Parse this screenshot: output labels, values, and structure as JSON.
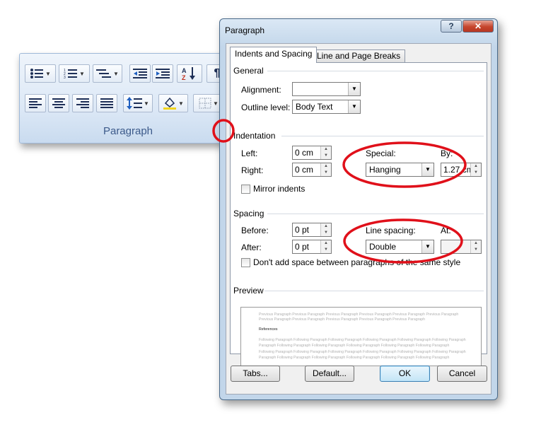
{
  "ribbon": {
    "group_label": "Paragraph",
    "buttons": [
      "bullets-icon",
      "numbering-icon",
      "multilevel-list-icon",
      "decrease-indent-icon",
      "increase-indent-icon",
      "sort-icon",
      "show-marks-icon",
      "align-left-icon",
      "center-icon",
      "align-right-icon",
      "justify-icon",
      "line-spacing-icon",
      "shading-icon",
      "borders-icon"
    ]
  },
  "dialog": {
    "title": "Paragraph",
    "help": "?",
    "close": "✕",
    "tabs": [
      "Indents and Spacing",
      "Line and Page Breaks"
    ],
    "general": {
      "heading": "General",
      "alignment_label": "Alignment:",
      "alignment_value": "",
      "outline_label": "Outline level:",
      "outline_value": "Body Text"
    },
    "indentation": {
      "heading": "Indentation",
      "left_label": "Left:",
      "left_value": "0 cm",
      "right_label": "Right:",
      "right_value": "0 cm",
      "special_label": "Special:",
      "special_value": "Hanging",
      "by_label": "By:",
      "by_value": "1.27 cm",
      "mirror_label": "Mirror indents"
    },
    "spacing": {
      "heading": "Spacing",
      "before_label": "Before:",
      "before_value": "0 pt",
      "after_label": "After:",
      "after_value": "0 pt",
      "line_spacing_label": "Line spacing:",
      "line_spacing_value": "Double",
      "at_label": "At:",
      "at_value": "",
      "dont_add_label": "Don't add space between paragraphs of the same style"
    },
    "preview": {
      "heading": "Preview",
      "previous": [
        "Previous Paragraph Previous Paragraph Previous Paragraph Previous Paragraph Previous Paragraph Previous Paragraph",
        "Previous Paragraph Previous Paragraph Previous Paragraph Previous Paragraph Previous Paragraph"
      ],
      "current": "References",
      "following": [
        "Following Paragraph Following Paragraph Following Paragraph Following Paragraph Following Paragraph Following Paragraph",
        "Paragraph Following Paragraph Following Paragraph Following Paragraph Following Paragraph Following Paragraph",
        "Following Paragraph Following Paragraph Following Paragraph Following Paragraph Following Paragraph Following Paragraph",
        "Paragraph Following Paragraph Following Paragraph Following Paragraph Following Paragraph Following Paragraph"
      ]
    },
    "buttons": {
      "tabs": "Tabs...",
      "default": "Default...",
      "ok": "OK",
      "cancel": "Cancel"
    }
  },
  "colors": {
    "highlight_circle": "#e0101a",
    "ribbon_label": "#3c5a8a"
  }
}
